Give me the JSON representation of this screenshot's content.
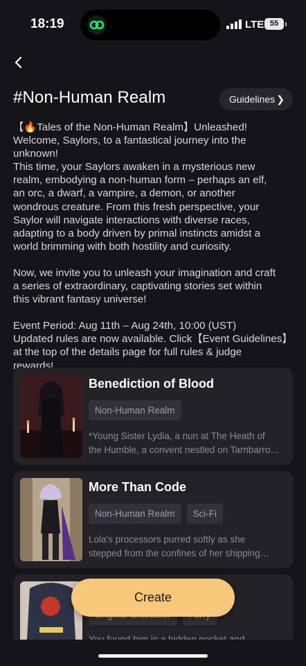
{
  "status_bar": {
    "time": "18:19",
    "network": "LTE",
    "battery": "55"
  },
  "header": {
    "back_icon": "chevron-left-icon",
    "title": "#Non-Human Realm",
    "guidelines_label": "Guidelines",
    "guidelines_icon": "chevron-right-icon"
  },
  "description": {
    "lines": [
      "【🔥Tales of the Non-Human Realm】Unleashed!",
      "Welcome, Saylors, to a fantastical journey into the",
      "unknown!",
      "This time, your Saylors awaken in a mysterious new",
      "realm, embodying a non-human form – perhaps an elf,",
      "an orc, a dwarf, a vampire, a demon, or another",
      "wondrous creature. From this fresh perspective, your",
      "Saylor will navigate interactions with diverse races,",
      "adapting to a body driven by primal instincts amidst a",
      "world brimming with both hostility and curiosity.",
      "",
      "Now, we invite you to unleash your imagination and craft",
      "a series of extraordinary, captivating stories set within",
      "this vibrant fantasy universe!",
      "",
      "Event Period: Aug 11th – Aug 24th, 10:00 (UST)",
      "Updated rules are now available. Click【Event Guidelines】",
      "at the top of the details page for full rules & judge",
      "rewards!"
    ]
  },
  "stories": [
    {
      "title": "Benediction of Blood",
      "tags": [
        "Non-Human Realm"
      ],
      "excerpt_lines": [
        "*Young Sister Lydia, a nun at The Heath of",
        "the Humble, a convent nestled on Tarnbarrow…"
      ]
    },
    {
      "title": "More Than Code",
      "tags": [
        "Non-Human Realm",
        "Sci-Fi"
      ],
      "excerpt_lines": [
        "Lola's processors purred softly as she",
        "stepped from the confines of her shipping…"
      ]
    },
    {
      "title": "",
      "tags": [
        "Original Character",
        "Furry"
      ],
      "excerpt_lines": [
        "You found him in a hidden pocket and…"
      ]
    }
  ],
  "create_label": "Create",
  "colors": {
    "background": "#151519",
    "card": "#222227",
    "accent": "#f7c87a",
    "app_icon": "#2fe36f"
  }
}
